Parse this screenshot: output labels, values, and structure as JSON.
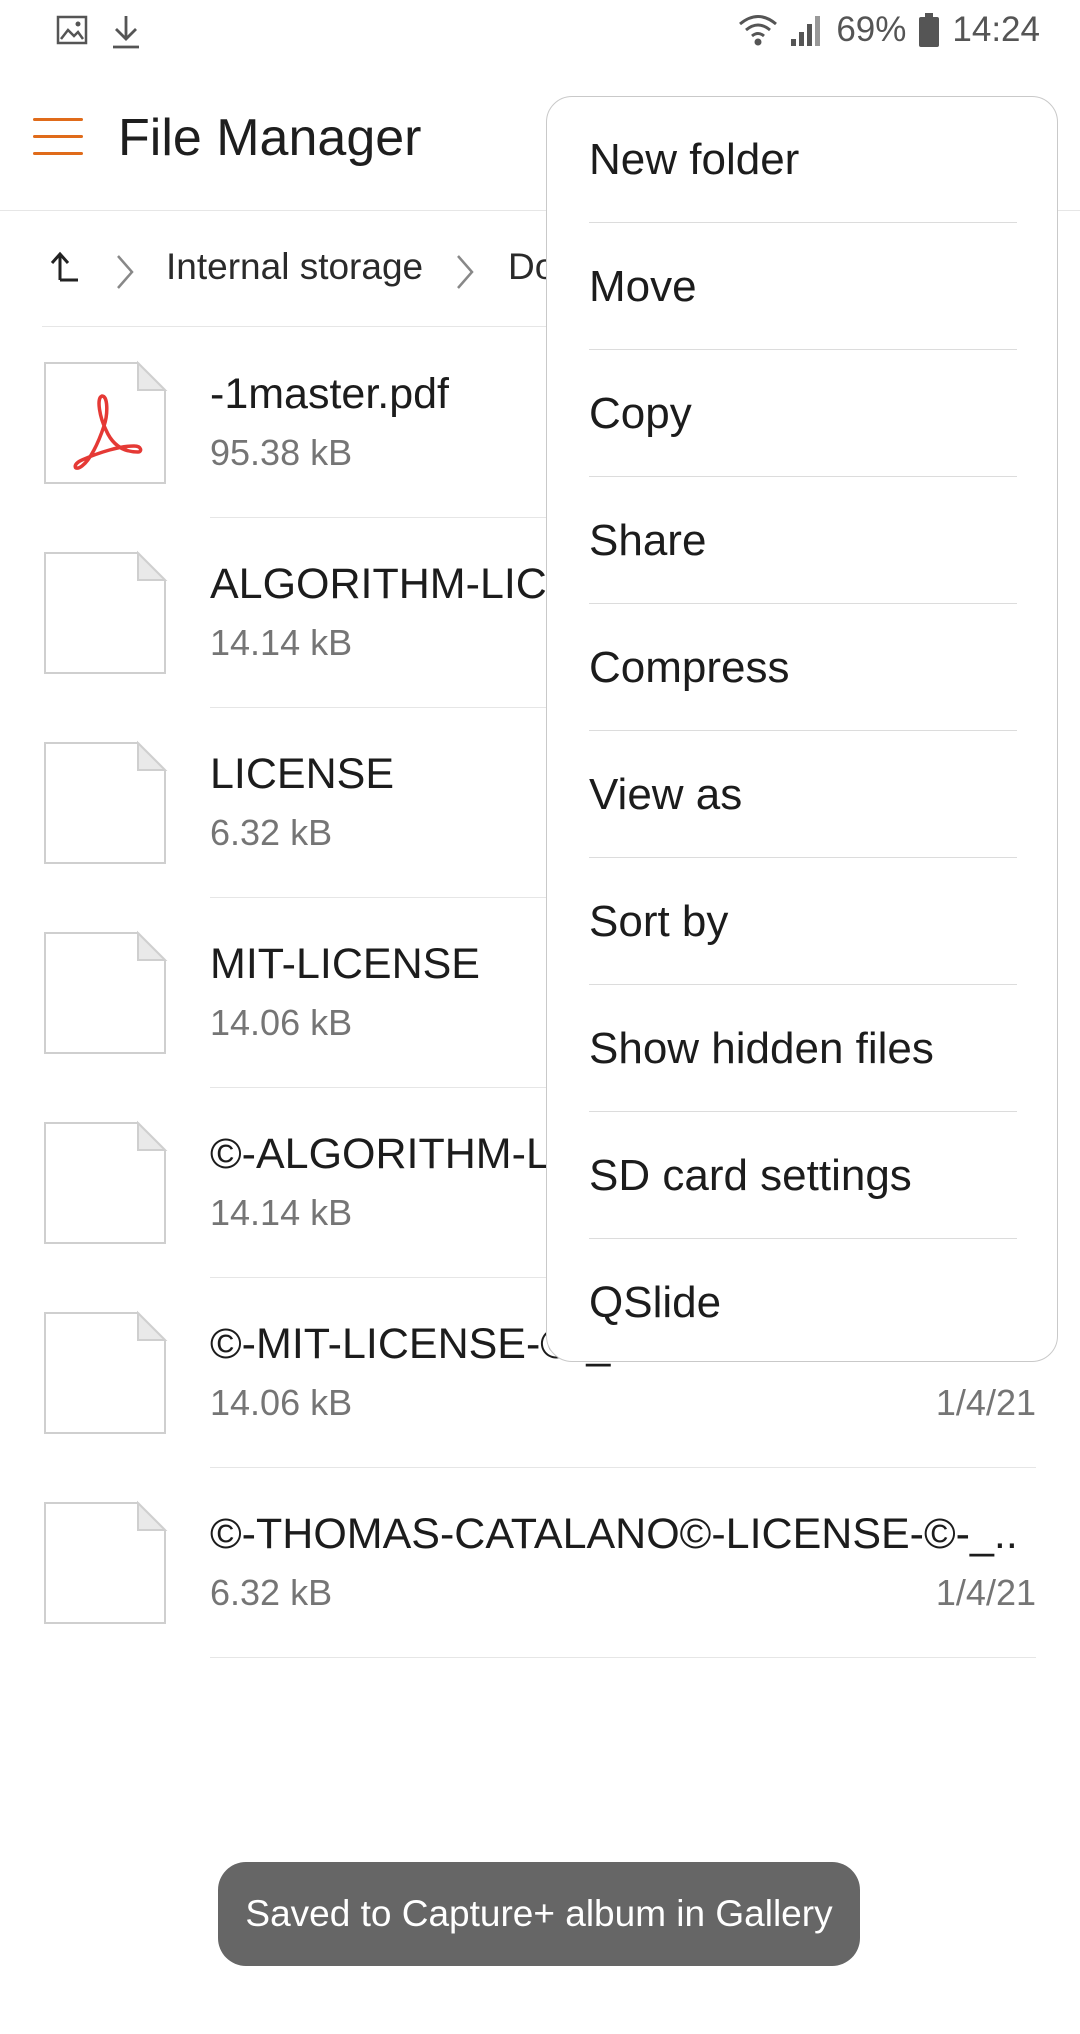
{
  "status_bar": {
    "left_icons": [
      "gallery-icon",
      "download-icon"
    ],
    "battery_percent": "69%",
    "time": "14:24"
  },
  "app_bar": {
    "title": "File Manager",
    "menu_icon": "hamburger-icon",
    "accent_color": "#e06b1a"
  },
  "breadcrumb": {
    "up_icon": "up-arrow-icon",
    "items": [
      "Internal storage",
      "Do"
    ]
  },
  "files": [
    {
      "name": "-1master.pdf",
      "size": "95.38 kB",
      "date": "",
      "icon": "pdf-icon"
    },
    {
      "name": "ALGORITHM-LIC",
      "size": "14.14 kB",
      "date": "",
      "icon": "file-icon"
    },
    {
      "name": "LICENSE",
      "size": "6.32 kB",
      "date": "",
      "icon": "file-icon"
    },
    {
      "name": "MIT-LICENSE",
      "size": "14.06 kB",
      "date": "",
      "icon": "file-icon"
    },
    {
      "name": "©-ALGORITHM-L",
      "size": "14.14 kB",
      "date": "",
      "icon": "file-icon"
    },
    {
      "name": "©-MIT-LICENSE-©-_.©",
      "size": "14.06 kB",
      "date": "1/4/21",
      "icon": "file-icon"
    },
    {
      "name": "©-THOMAS-CATALANO©-LICENSE-©-_..",
      "size": "6.32 kB",
      "date": "1/4/21",
      "icon": "file-icon"
    }
  ],
  "overflow_menu": {
    "items": [
      "New folder",
      "Move",
      "Copy",
      "Share",
      "Compress",
      "View as",
      "Sort by",
      "Show hidden files",
      "SD card settings",
      "QSlide"
    ]
  },
  "toast": {
    "message": "Saved to Capture+ album in Gallery"
  }
}
